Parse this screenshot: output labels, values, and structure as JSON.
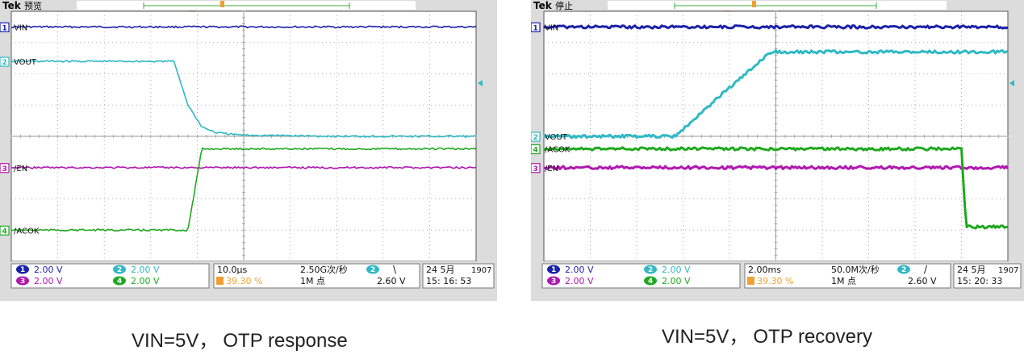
{
  "colors": {
    "ch1": "#1c22a8",
    "ch2": "#2fb9c4",
    "ch3": "#b018b0",
    "ch4": "#1fa91f",
    "trigger": "#f0a030",
    "screen_bg": "#ffffff",
    "grid": "#9a9a9a"
  },
  "chart_data": [
    {
      "type": "line",
      "title": "",
      "brand": "Tek",
      "state": "预览",
      "channel_labels": [
        "VIN",
        "VOUT",
        "/EN",
        "/ACOK"
      ],
      "channel_numbers": [
        "1",
        "2",
        "3",
        "4"
      ],
      "grid": true,
      "divisions": [
        10,
        8
      ],
      "x": [
        0,
        1,
        2,
        3,
        3.5,
        3.8,
        4.1,
        4.4,
        4.7,
        5,
        6,
        7,
        8,
        9,
        10
      ],
      "series": [
        {
          "name": "VIN",
          "channel": 1,
          "values": [
            7.5,
            7.5,
            7.5,
            7.5,
            7.5,
            7.5,
            7.5,
            7.5,
            7.5,
            7.5,
            7.5,
            7.5,
            7.5,
            7.5,
            7.5
          ]
        },
        {
          "name": "VOUT",
          "channel": 2,
          "values": [
            6.4,
            6.4,
            6.4,
            6.4,
            6.4,
            5.0,
            4.3,
            4.12,
            4.07,
            4.04,
            4.02,
            4.0,
            4.0,
            4.0,
            4.0
          ]
        },
        {
          "name": "/EN",
          "channel": 3,
          "values": [
            3.0,
            3.0,
            3.0,
            3.0,
            3.0,
            3.0,
            3.0,
            3.0,
            3.0,
            3.0,
            3.0,
            3.0,
            3.0,
            3.0,
            3.0
          ]
        },
        {
          "name": "/ACOK",
          "channel": 4,
          "values": [
            1.0,
            1.0,
            1.0,
            1.0,
            1.0,
            1.0,
            3.6,
            3.6,
            3.6,
            3.6,
            3.6,
            3.6,
            3.6,
            3.6,
            3.6
          ]
        }
      ],
      "status": {
        "ch1_scale": "2.00 V",
        "ch2_scale": "2.00 V",
        "ch3_scale": "2.00 V",
        "ch4_scale": "2.00 V",
        "timebase": "10.0µs",
        "trigger_position": "39.30 %",
        "sample_rate": "2.50G次/秒",
        "record_length": "1M 点",
        "trigger_channel": "2",
        "trigger_slope": "\\",
        "trigger_level": "2.60 V",
        "date": "24 5月",
        "code": "1907",
        "time": "15: 16: 53"
      }
    },
    {
      "type": "line",
      "title": "",
      "brand": "Tek",
      "state": "停止",
      "channel_labels": [
        "VIN",
        "VOUT",
        "/EN",
        "/ACOK"
      ],
      "channel_numbers": [
        "1",
        "2",
        "3",
        "4"
      ],
      "grid": true,
      "divisions": [
        10,
        8
      ],
      "x": [
        0,
        1,
        2,
        2.85,
        3,
        4,
        4.9,
        5,
        6,
        7,
        8,
        9,
        9.1,
        9.2,
        10
      ],
      "series": [
        {
          "name": "VIN",
          "channel": 1,
          "values": [
            7.5,
            7.5,
            7.5,
            7.5,
            7.5,
            7.5,
            7.5,
            7.5,
            7.5,
            7.5,
            7.5,
            7.5,
            7.5,
            7.5,
            7.5
          ]
        },
        {
          "name": "VOUT",
          "channel": 2,
          "values": [
            4.0,
            4.0,
            4.0,
            4.0,
            4.23,
            5.56,
            6.7,
            6.7,
            6.7,
            6.7,
            6.7,
            6.7,
            6.7,
            6.7,
            6.7
          ]
        },
        {
          "name": "/EN",
          "channel": 3,
          "values": [
            3.0,
            3.0,
            3.0,
            3.0,
            3.0,
            3.0,
            3.0,
            3.0,
            3.0,
            3.0,
            3.0,
            3.0,
            3.0,
            3.0,
            3.0
          ]
        },
        {
          "name": "/ACOK",
          "channel": 4,
          "values": [
            3.6,
            3.6,
            3.6,
            3.6,
            3.6,
            3.6,
            3.6,
            3.6,
            3.6,
            3.6,
            3.6,
            3.6,
            1.1,
            1.1,
            1.1
          ]
        }
      ],
      "status": {
        "ch1_scale": "2.00 V",
        "ch2_scale": "2.00 V",
        "ch3_scale": "2.00 V",
        "ch4_scale": "2.00 V",
        "timebase": "2.00ms",
        "trigger_position": "39.30 %",
        "sample_rate": "50.0M次/秒",
        "record_length": "1M 点",
        "trigger_channel": "2",
        "trigger_slope": "/",
        "trigger_level": "2.60 V",
        "date": "24 5月",
        "code": "1907",
        "time": "15: 20: 33"
      }
    }
  ],
  "captions": [
    {
      "condition": "VIN=5V，",
      "title": "OTP response"
    },
    {
      "condition": "VIN=5V，",
      "title": "OTP recovery"
    }
  ]
}
